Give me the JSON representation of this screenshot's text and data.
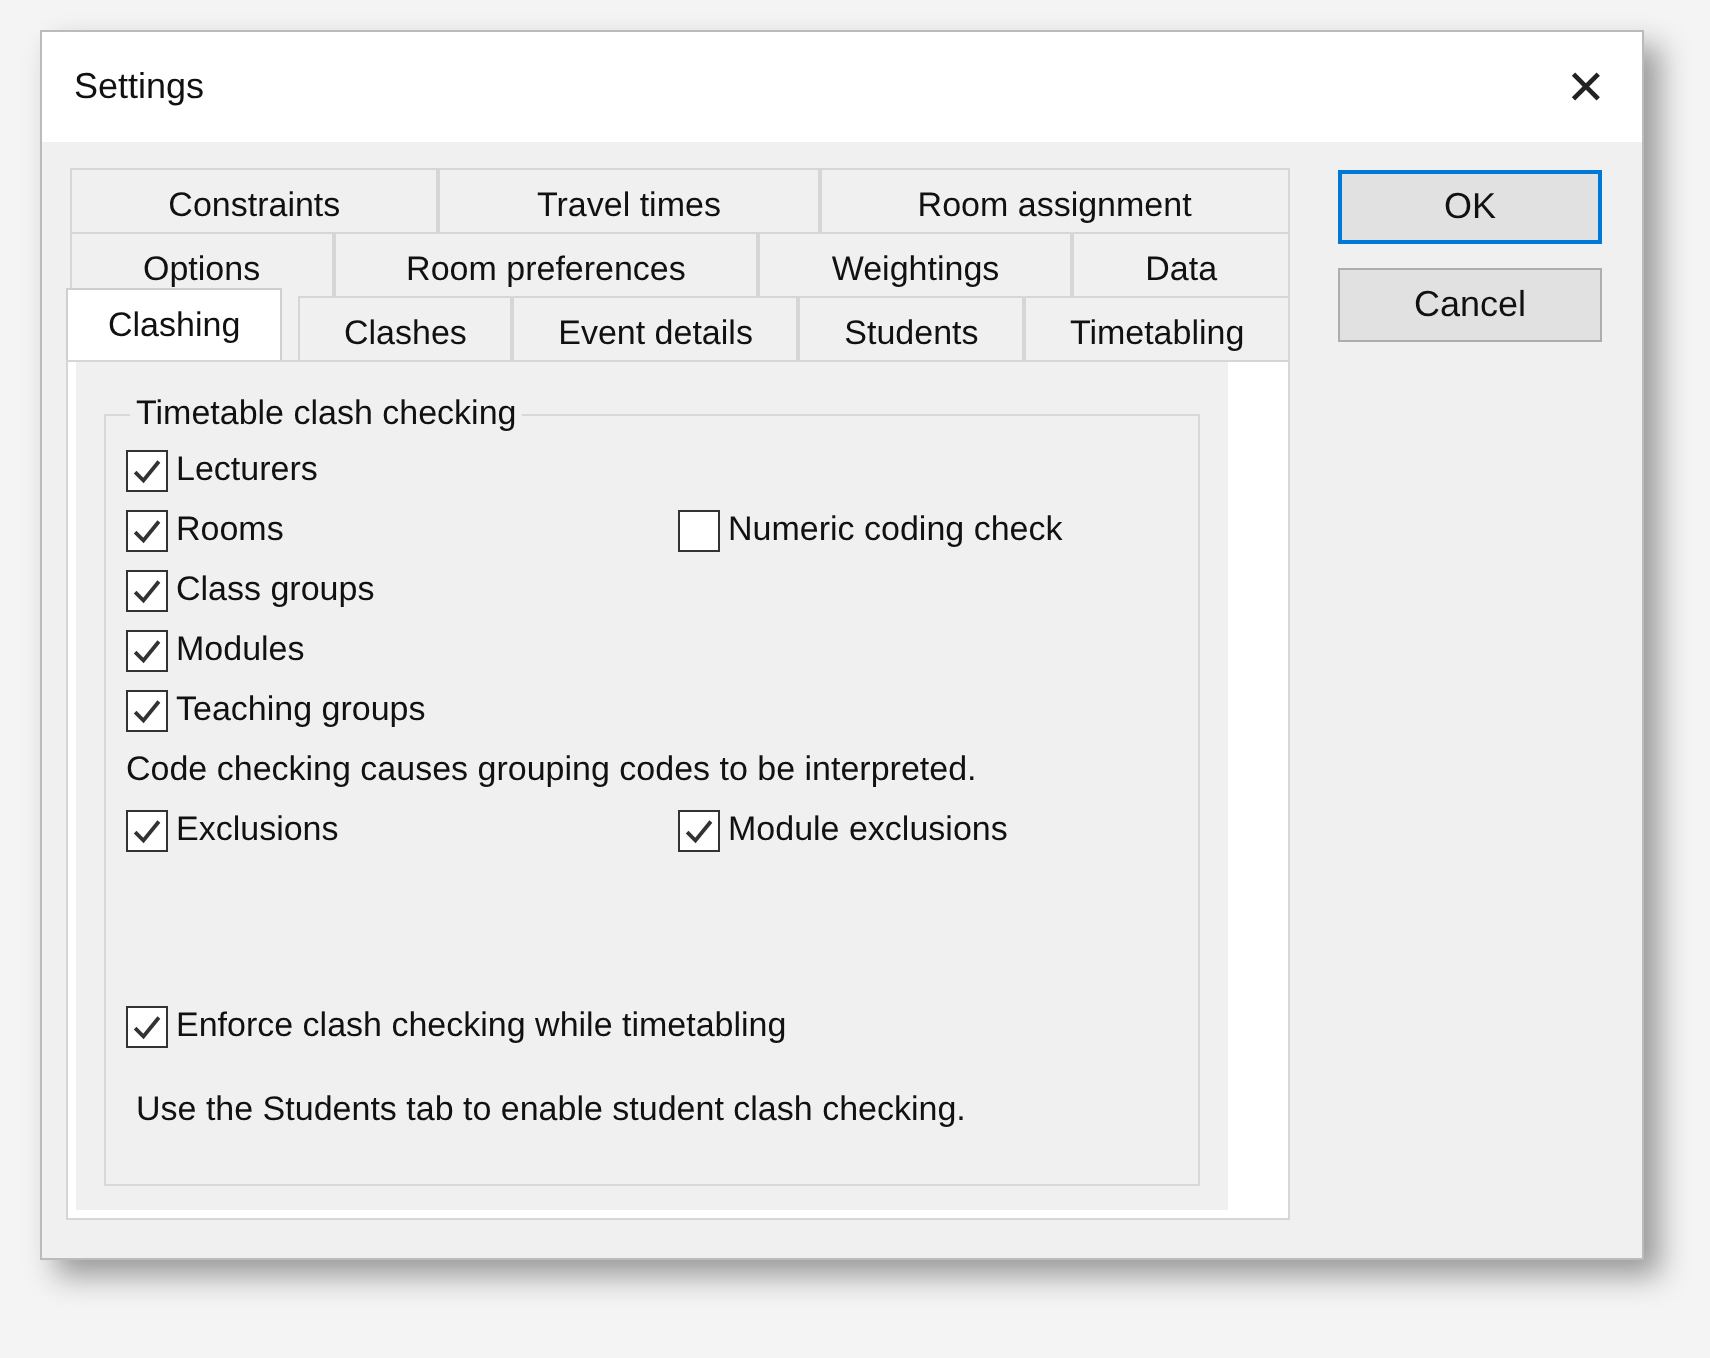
{
  "window": {
    "title": "Settings",
    "close": "✕"
  },
  "tab_rows": [
    [
      {
        "label": "Constraints",
        "selected": false
      },
      {
        "label": "Travel times",
        "selected": false
      },
      {
        "label": "Room assignment",
        "selected": false
      }
    ],
    [
      {
        "label": "Options",
        "selected": false
      },
      {
        "label": "Room preferences",
        "selected": false
      },
      {
        "label": "Weightings",
        "selected": false
      },
      {
        "label": "Data",
        "selected": false
      }
    ],
    [
      {
        "label": "Clashing",
        "selected": true
      },
      {
        "label": "Clashes",
        "selected": false
      },
      {
        "label": "Event details",
        "selected": false
      },
      {
        "label": "Students",
        "selected": false
      },
      {
        "label": "Timetabling",
        "selected": false
      }
    ]
  ],
  "buttons": [
    {
      "label": "OK",
      "default": true
    },
    {
      "label": "Cancel",
      "default": false
    }
  ],
  "group": {
    "title": "Timetable clash checking",
    "rows": [
      [
        {
          "kind": "checkbox",
          "label": "Lecturers",
          "checked": true
        }
      ],
      [
        {
          "kind": "checkbox",
          "label": "Rooms",
          "checked": true
        },
        {
          "kind": "checkbox",
          "label": "Numeric coding check",
          "checked": false
        }
      ],
      [
        {
          "kind": "checkbox",
          "label": "Class groups",
          "checked": true
        }
      ],
      [
        {
          "kind": "checkbox",
          "label": "Modules",
          "checked": true
        }
      ],
      [
        {
          "kind": "checkbox",
          "label": "Teaching groups",
          "checked": true
        }
      ],
      [
        {
          "kind": "note",
          "label": "Code checking causes grouping codes to be interpreted."
        }
      ],
      [
        {
          "kind": "checkbox",
          "label": "Exclusions",
          "checked": true
        },
        {
          "kind": "checkbox",
          "label": "Module exclusions",
          "checked": true
        }
      ]
    ],
    "footer": [
      [
        {
          "kind": "checkbox",
          "label": "Enforce clash checking while timetabling",
          "checked": true
        }
      ],
      [
        {
          "kind": "note",
          "label": "Use the Students tab to enable student clash checking."
        }
      ]
    ]
  }
}
